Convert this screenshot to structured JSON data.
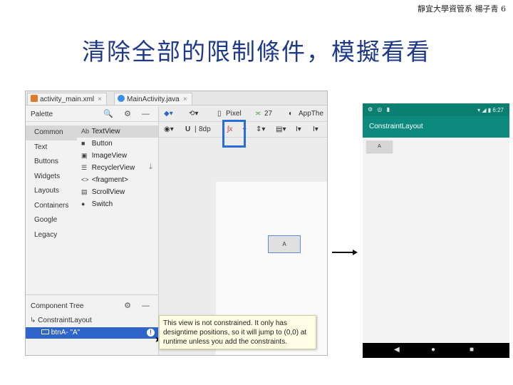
{
  "slide": {
    "header_note": "靜宜大學資管系 楊子青 6",
    "title": "清除全部的限制條件，模擬看看"
  },
  "studio": {
    "tabs": [
      {
        "label": "activity_main.xml",
        "close": "×",
        "icon_color": "#e07b2a"
      },
      {
        "label": "MainActivity.java",
        "close": "×",
        "icon_color": "#3a8ee6"
      }
    ],
    "palette": {
      "title": "Palette",
      "header_icons": "🔍 ⚙ —",
      "categories": [
        "Common",
        "Text",
        "Buttons",
        "Widgets",
        "Layouts",
        "Containers",
        "Google",
        "Legacy"
      ],
      "widgets": [
        {
          "icon": "Ab",
          "label": "TextView"
        },
        {
          "icon": "■",
          "label": "Button"
        },
        {
          "icon": "▣",
          "label": "ImageView"
        },
        {
          "icon": "☰",
          "label": "RecyclerView"
        },
        {
          "icon": "<>",
          "label": "<fragment>"
        },
        {
          "icon": "▤",
          "label": "ScrollView"
        },
        {
          "icon": "●",
          "label": "Switch"
        }
      ]
    },
    "component_tree": {
      "title": "Component Tree",
      "icons": "⚙ —",
      "root": "ConstraintLayout",
      "child": "btnA- \"A\"",
      "error_icon": "!"
    },
    "toolbar1": {
      "pixel": "Pixel",
      "api": "27",
      "app": "AppThe"
    },
    "toolbar2": {
      "margin": "8dp"
    },
    "canvas_button": "A",
    "tooltip": "This view is not constrained. It only has designtime positions, so it will jump to (0,0) at runtime unless you add the constraints."
  },
  "phone": {
    "time": "6:27",
    "app_title": "ConstraintLayout",
    "button_label": "A",
    "nav_back": "◀",
    "nav_home": "●",
    "nav_recent": "■",
    "colors": {
      "status": "#0a7f72",
      "appbar": "#0b8a7d"
    }
  }
}
